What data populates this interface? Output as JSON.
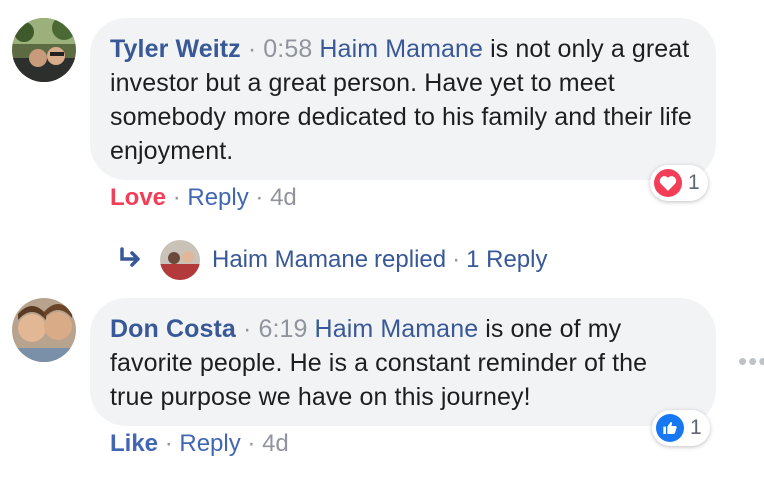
{
  "comments": [
    {
      "author": "Tyler Weitz",
      "timestamp": "0:58",
      "mention": "Haim Mamane",
      "text": "is not only a great investor but a great person. Have yet to meet somebody more dedicated to his family and their life enjoyment.",
      "reaction_label": "Love",
      "reply_label": "Reply",
      "age": "4d",
      "reaction_icon": "heart-icon",
      "reaction_count": "1",
      "reaction_color": "#f33e58"
    },
    {
      "author": "Don Costa",
      "timestamp": "6:19",
      "mention": "Haim Mamane",
      "text": "is one of my favorite people. He is a constant reminder of the true purpose we have on this journey!",
      "reaction_label": "Like",
      "reply_label": "Reply",
      "age": "4d",
      "reaction_icon": "thumbs-up-icon",
      "reaction_count": "1",
      "reaction_color": "#1877f2"
    }
  ],
  "replies_summary": {
    "replier": "Haim Mamane",
    "verb": "replied",
    "count_label": "1 Reply"
  },
  "separator": "·",
  "more_icon": "more-options-icon",
  "more_glyph": "•••"
}
